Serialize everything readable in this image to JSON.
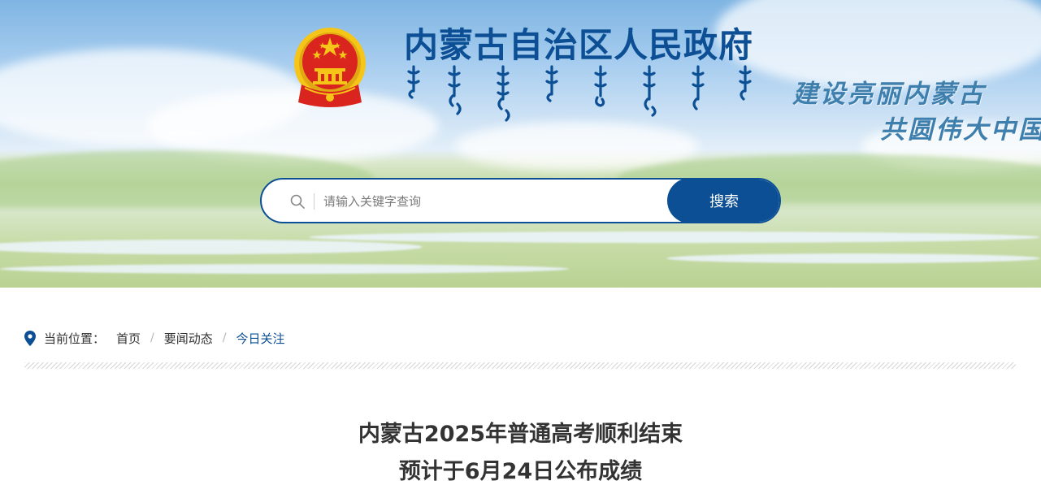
{
  "header": {
    "site_title": "内蒙古自治区人民政府",
    "mongolian_title_image": "mongolian-script-title",
    "slogan_line1": "建设亮丽内蒙古",
    "slogan_line2": "共圆伟大中国梦",
    "emblem": "national-emblem"
  },
  "search": {
    "placeholder": "请输入关键字查询",
    "value": "",
    "button_label": "搜索",
    "icon": "search-icon"
  },
  "breadcrumb": {
    "icon": "location-pin-icon",
    "label": "当前位置：",
    "items": [
      "首页",
      "要闻动态",
      "今日关注"
    ],
    "separator": "/"
  },
  "article": {
    "title_line1": "内蒙古2025年普通高考顺利结束",
    "title_line2": "预计于6月24日公布成绩"
  },
  "colors": {
    "brand_blue": "#0c4f94",
    "slogan_blue": "#3f7fae",
    "emblem_red": "#d9251d",
    "emblem_gold": "#f5c518"
  }
}
